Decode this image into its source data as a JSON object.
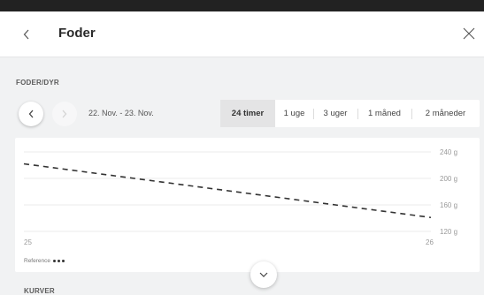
{
  "header": {
    "title": "Foder",
    "back_icon": "chevron-left-icon",
    "close_icon": "close-icon"
  },
  "section": {
    "label": "FODER/DYR"
  },
  "date_nav": {
    "range": "22. Nov. - 23. Nov.",
    "prev_icon": "chevron-left-icon",
    "next_icon": "chevron-right-icon"
  },
  "tabs": [
    {
      "label": "24 timer",
      "active": true
    },
    {
      "label": "1 uge",
      "active": false
    },
    {
      "label": "3 uger",
      "active": false
    },
    {
      "label": "1 måned",
      "active": false
    },
    {
      "label": "2 måneder",
      "active": false
    }
  ],
  "chart_data": {
    "type": "line",
    "x_ticks": [
      "25",
      "26"
    ],
    "y_ticks": [
      "240 g",
      "200 g",
      "160 g",
      "120 g"
    ],
    "y_values": [
      240,
      200,
      160,
      120
    ],
    "ylim": [
      120,
      240
    ],
    "grid": true,
    "series": [
      {
        "name": "Reference",
        "style": "dashed",
        "color": "#333333",
        "x": [
          "25",
          "26"
        ],
        "y": [
          222,
          141
        ]
      }
    ],
    "legend": {
      "label": "Reference",
      "placement": "bottom-left"
    }
  },
  "footer": {
    "expand_icon": "chevron-down-icon",
    "next_section_label": "KURVER"
  },
  "colors": {
    "background": "#f1f2f3",
    "card": "#ffffff",
    "active_tab": "#e4e4e5",
    "topbar": "#222222"
  }
}
